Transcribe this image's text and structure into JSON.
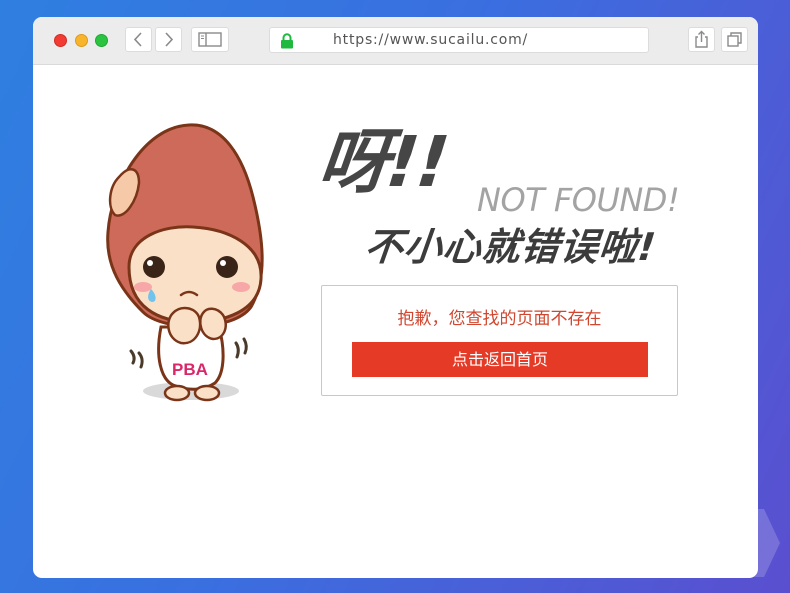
{
  "browser": {
    "url": "https://www.sucailu.com/",
    "icons": [
      "back-icon",
      "forward-icon",
      "sidebar-icon",
      "lock-icon",
      "share-icon",
      "tabs-icon"
    ]
  },
  "page": {
    "headline": "呀!!",
    "not_found": "NOT FOUND!",
    "subhead": "不小心就错误啦!",
    "message": "抱歉，您查找的页面不存在",
    "home_button": "点击返回首页",
    "mascot_badge": "PBA"
  },
  "colors": {
    "accent": "#e53a26",
    "message": "#d0462f",
    "headline": "#464646",
    "not_found": "#a3a3a3",
    "background_start": "#2f7fe0",
    "background_end": "#5a4fcf"
  }
}
